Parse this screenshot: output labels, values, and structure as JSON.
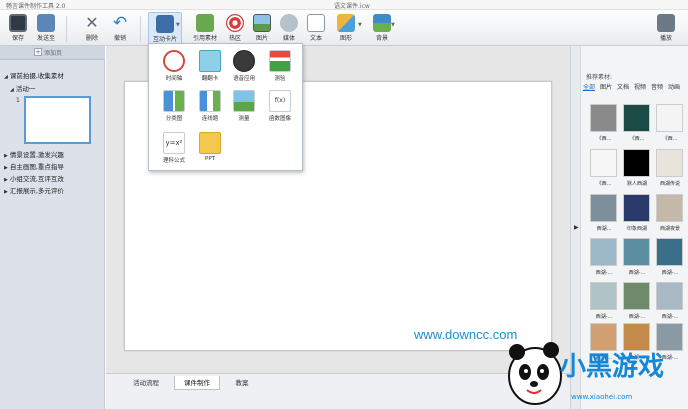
{
  "window": {
    "app_title": "畅言课件制作工具 2.0",
    "file_title": "语文课件.icw"
  },
  "toolbar": {
    "save": "保存",
    "publish": "发送至",
    "delete": "删除",
    "undo": "撤销",
    "interactive_card": "互动卡片",
    "cite_material": "引用素材",
    "hotspot": "热区",
    "image": "图片",
    "media": "媒体",
    "text": "文本",
    "shape": "图形",
    "background": "背景",
    "more": "播放"
  },
  "popup": {
    "items": [
      {
        "label": "时间轴",
        "icon": "clock-icon"
      },
      {
        "label": "翻翻卡",
        "icon": "flip-card-icon"
      },
      {
        "label": "语音应用",
        "icon": "headset-icon"
      },
      {
        "label": "测验",
        "icon": "quiz-icon"
      },
      {
        "label": "分类图",
        "icon": "classify-icon"
      },
      {
        "label": "连线题",
        "icon": "match-lines-icon"
      },
      {
        "label": "测量",
        "icon": "measure-icon"
      },
      {
        "label": "函数图像",
        "icon": "function-graph-icon"
      },
      {
        "label": "理科公式",
        "icon": "formula-icon"
      },
      {
        "label": "PPT",
        "icon": "ppt-icon"
      }
    ],
    "formula_glyph": "y=x²",
    "function_glyph": "f(x)"
  },
  "sidebar": {
    "add_page": "添加页",
    "items": [
      {
        "label": "课前拍摄,收集素材",
        "expanded": true
      },
      {
        "label": "活动一",
        "expanded": true
      },
      {
        "label": "情景设置,激发兴趣",
        "expanded": false
      },
      {
        "label": "自主画图,重点指导",
        "expanded": false
      },
      {
        "label": "小组交流,互评互改",
        "expanded": false
      },
      {
        "label": "汇报展示,多元评价",
        "expanded": false
      }
    ],
    "page_number": "1"
  },
  "canvas": {
    "watermark": "www.downcc.com"
  },
  "bottom_tabs": [
    {
      "label": "活动流程",
      "active": false
    },
    {
      "label": "课件制作",
      "active": true
    },
    {
      "label": "教案",
      "active": false
    }
  ],
  "right_panel": {
    "title": "推荐素材:",
    "tabs": [
      "全部",
      "图片",
      "文档",
      "视频",
      "音频",
      "动画"
    ],
    "active_tab": "全部",
    "thumbs": [
      {
        "caption": "《西...",
        "color": "#8a8a8a"
      },
      {
        "caption": "《西...",
        "color": "#1c4b45"
      },
      {
        "caption": "《西...",
        "color": "#f4f4f4"
      },
      {
        "caption": "《西...",
        "color": "#f6f6f6"
      },
      {
        "caption": "默人西湖",
        "color": "#000000"
      },
      {
        "caption": "西湖传说",
        "color": "#e8e3dc"
      },
      {
        "caption": "西湖...",
        "color": "#7d8f9b"
      },
      {
        "caption": "印象西湖",
        "color": "#2a3a6a"
      },
      {
        "caption": "西湖夜景",
        "color": "#c4b8a8"
      },
      {
        "caption": "西湖-...",
        "color": "#9ab8c8"
      },
      {
        "caption": "西湖-...",
        "color": "#5d8fa3"
      },
      {
        "caption": "西湖-...",
        "color": "#3a6f8a"
      },
      {
        "caption": "西湖-...",
        "color": "#b0c4c8"
      },
      {
        "caption": "西湖-...",
        "color": "#6e8a6a"
      },
      {
        "caption": "西湖-...",
        "color": "#a8b8c4"
      },
      {
        "caption": "西湖-...",
        "color": "#d0a070"
      },
      {
        "caption": "西湖-...",
        "color": "#c48a4a"
      },
      {
        "caption": "西湖-...",
        "color": "#8a9aa4"
      }
    ]
  },
  "logo": {
    "text": "小黑游戏",
    "url": "www.xiaohei.com"
  }
}
